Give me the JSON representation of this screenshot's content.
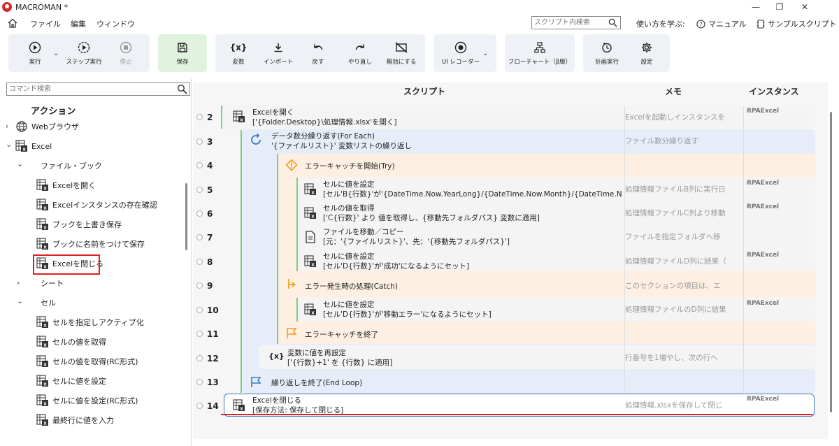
{
  "window": {
    "title": "MACROMAN *",
    "controls": [
      "—",
      "❐",
      "✕"
    ]
  },
  "menu": {
    "items": [
      "ファイル",
      "編集",
      "ウィンドウ"
    ],
    "search_placeholder": "スクリプト内検索",
    "learn_label": "使い方を学ぶ:",
    "manual_label": "マニュアル",
    "sample_label": "サンプルスクリプト"
  },
  "toolbar": {
    "run": "実行",
    "step": "ステップ実行",
    "stop": "停止",
    "save": "保存",
    "variable": "変数",
    "import": "インポート",
    "undo": "戻す",
    "redo": "やり直し",
    "disable": "無効にする",
    "recorder": "UI レコーダー",
    "flowchart": "フローチャート（β版）",
    "schedule": "計画実行",
    "settings": "設定",
    "variable_glyph": "{x}"
  },
  "left": {
    "search_placeholder": "コマンド検索",
    "heading": "アクション",
    "tree": [
      {
        "label": "Webブラウザ",
        "chev": "›"
      },
      {
        "label": "Excel",
        "chev": "⌄"
      },
      {
        "label": "ファイル・ブック",
        "chev": "⌄"
      },
      {
        "label": "Excelを開く"
      },
      {
        "label": "Excelインスタンスの存在確認"
      },
      {
        "label": "ブックを上書き保存"
      },
      {
        "label": "ブックに名前をつけて保存"
      },
      {
        "label": "Excelを閉じる"
      },
      {
        "label": "シート",
        "chev": "›"
      },
      {
        "label": "セル",
        "chev": "⌄"
      },
      {
        "label": "セルを指定しアクティブ化"
      },
      {
        "label": "セルの値を取得"
      },
      {
        "label": "セルの値を取得(RC形式)"
      },
      {
        "label": "セルに値を設定"
      },
      {
        "label": "セルに値を設定(RC形式)"
      },
      {
        "label": "最終行に値を入力"
      }
    ]
  },
  "script": {
    "headers": {
      "script": "スクリプト",
      "memo": "メモ",
      "instance": "インスタンス"
    },
    "rows": [
      {
        "num": "2",
        "line1": "Excelを開く",
        "line2": "['{Folder.Desktop}\\処理情報.xlsx'を開く]",
        "memo": "Excelを起動しインスタンスを",
        "inst": "RPAExcel"
      },
      {
        "num": "3",
        "line1": "データ数分繰り返す(For Each)",
        "line2": "'{ファイルリスト}' 変数リストの繰り返し",
        "memo": "ファイル数分繰り返す",
        "inst": ""
      },
      {
        "num": "4",
        "line1": "エラーキャッチを開始(Try)",
        "line2": "",
        "memo": "",
        "inst": ""
      },
      {
        "num": "5",
        "line1": "セルに値を設定",
        "line2": "[セル'B{行数}'が'{DateTime.Now.YearLong}/{DateTime.Now.Month}/{DateTime.N",
        "memo": "処理情報ファイルB列に実行日",
        "inst": "RPAExcel"
      },
      {
        "num": "6",
        "line1": "セルの値を取得",
        "line2": "['C{行数}' より 値を取得し、{移動先フォルダパス} 変数に適用]",
        "memo": "処理情報ファイルC列より移動",
        "inst": "RPAExcel"
      },
      {
        "num": "7",
        "line1": "ファイルを移動／コピー",
        "line2": "[元：'{ファイルリスト}'、先：'{移動先フォルダパス}']",
        "memo": "ファイルを指定フォルダへ移",
        "inst": ""
      },
      {
        "num": "8",
        "line1": "セルに値を設定",
        "line2": "[セル'D{行数}'が'成功'になるようにセット]",
        "memo": "処理情報ファイルD列に結果（",
        "inst": "RPAExcel"
      },
      {
        "num": "9",
        "line1": "エラー発生時の処理(Catch)",
        "line2": "",
        "memo": "このセクションの項目は、エ",
        "inst": ""
      },
      {
        "num": "10",
        "line1": "セルに値を設定",
        "line2": "[セル'D{行数}'が'移動エラー'になるようにセット]",
        "memo": "処理情報ファイルのD列に結果",
        "inst": "RPAExcel"
      },
      {
        "num": "11",
        "line1": "エラーキャッチを終了",
        "line2": "",
        "memo": "",
        "inst": ""
      },
      {
        "num": "12",
        "line1": "変数に値を再設定",
        "line2": "['{行数}+1' を {行数} に適用]",
        "memo": "行番号を1増やし、次の行へ",
        "inst": ""
      },
      {
        "num": "13",
        "line1": "繰り返しを終了(End Loop)",
        "line2": "",
        "memo": "",
        "inst": ""
      },
      {
        "num": "14",
        "line1": "Excelを閉じる",
        "line2": "[保存方法: 保存して閉じる]",
        "memo": "処理情報.xlsxを保存して閉じ",
        "inst": "RPAExcel"
      }
    ]
  },
  "colors": {
    "loop": "#e6edf8",
    "try": "#fdf0e2",
    "accent_green": "#7ccf7c",
    "highlight_red": "#e02020",
    "select_blue": "#3a78c8"
  }
}
